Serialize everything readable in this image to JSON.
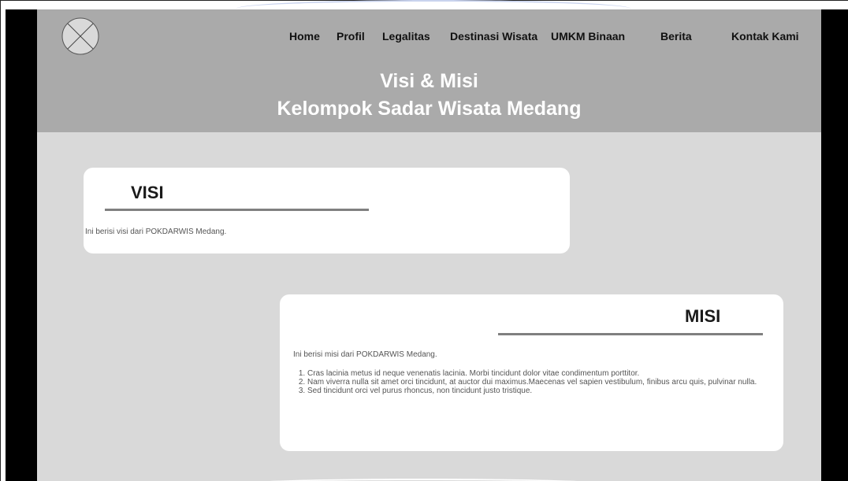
{
  "nav": {
    "items": [
      "Home",
      "Profil",
      "Legalitas",
      "Destinasi Wisata",
      "UMKM Binaan",
      "Berita",
      "Kontak Kami"
    ]
  },
  "hero": {
    "line1": "Visi & Misi",
    "line2": "Kelompok Sadar Wisata Medang"
  },
  "visi": {
    "title": "VISI",
    "text": "Ini berisi visi dari POKDARWIS Medang."
  },
  "misi": {
    "title": "MISI",
    "intro": "Ini berisi misi dari POKDARWIS Medang.",
    "items": [
      "Cras lacinia metus id neque venenatis lacinia. Morbi tincidunt dolor vitae condimentum porttitor.",
      "Nam viverra nulla sit amet orci tincidunt, at auctor dui maximus.Maecenas vel sapien vestibulum, finibus arcu quis, pulvinar nulla.",
      "Sed tincidunt orci vel purus rhoncus, non tincidunt justo tristique."
    ]
  },
  "colors": {
    "header_bg": "#aaaaaa",
    "page_bg": "#d9d9d9",
    "card_bg": "#ffffff",
    "side_bars": "#000000"
  },
  "icons": {
    "logo": "logo-placeholder-icon"
  }
}
